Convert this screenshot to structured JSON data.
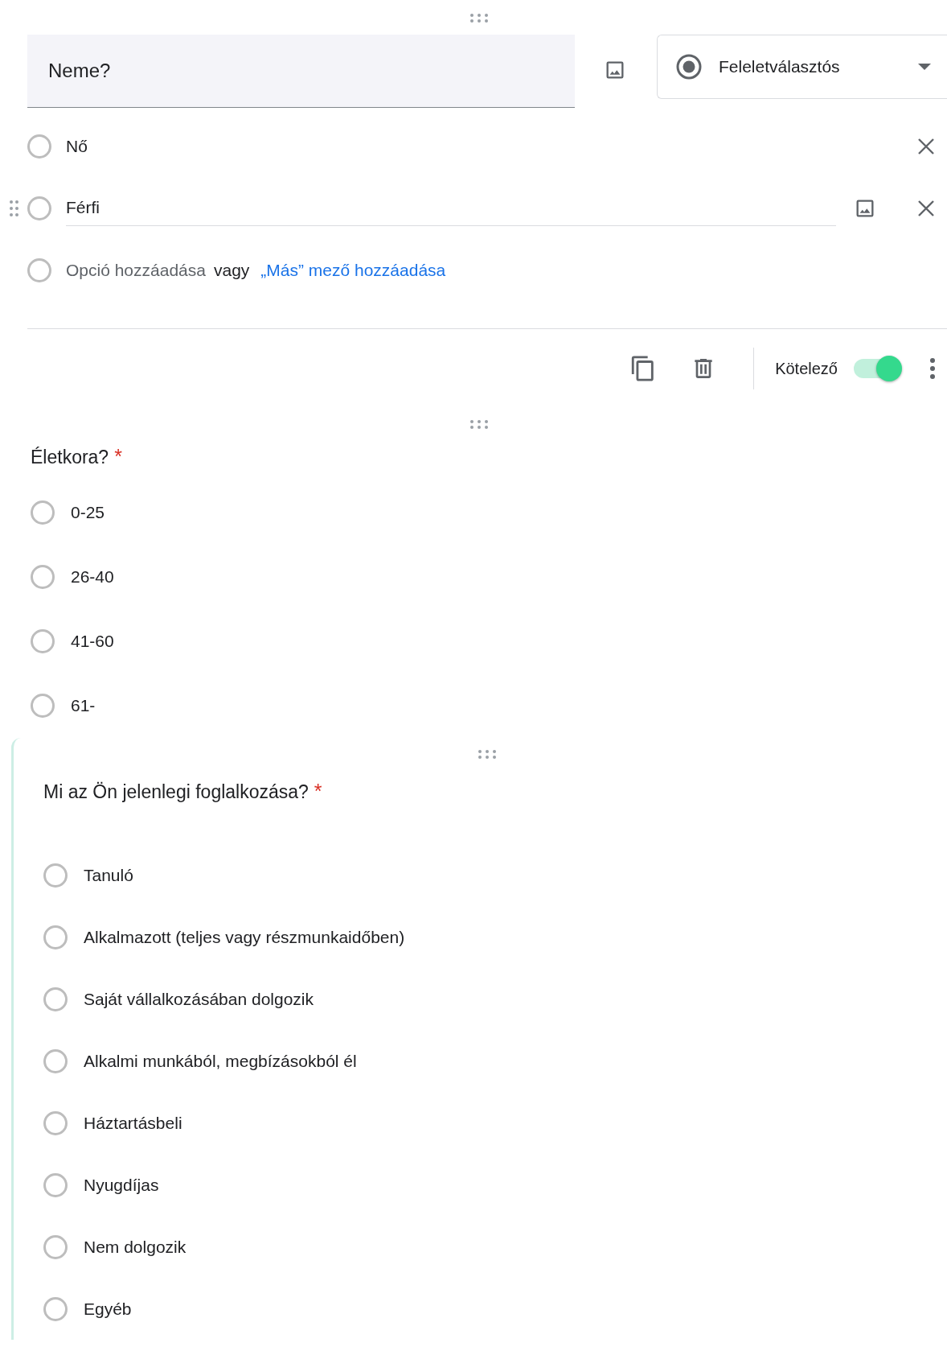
{
  "questions": [
    {
      "title": "Neme?",
      "kind": "editor",
      "type_select": {
        "label": "Feleletválasztós"
      },
      "options": [
        {
          "label": "Nő",
          "selected": false,
          "editing": false
        },
        {
          "label": "Férfi",
          "selected": false,
          "editing": true
        }
      ],
      "add_option": {
        "selected": false,
        "placeholder": "Opció hozzáadása",
        "separator": "vagy",
        "link": "„Más” mező hozzáadása"
      },
      "required_toggle": {
        "label": "Kötelező",
        "on": true
      }
    },
    {
      "title": "Életkora?",
      "kind": "preview",
      "required_mark": "*",
      "options": [
        {
          "label": "0-25",
          "selected": false
        },
        {
          "label": "26-40",
          "selected": false
        },
        {
          "label": "41-60",
          "selected": false
        },
        {
          "label": "61-",
          "selected": false
        }
      ]
    },
    {
      "title": "Mi az Ön jelenlegi foglalkozása?",
      "kind": "preview",
      "required_mark": "*",
      "focused": true,
      "options": [
        {
          "label": "Tanuló",
          "selected": false
        },
        {
          "label": "Alkalmazott (teljes vagy részmunkaidőben)",
          "selected": false
        },
        {
          "label": "Saját vállalkozásában dolgozik",
          "selected": false
        },
        {
          "label": "Alkalmi munkából, megbízásokból él",
          "selected": false
        },
        {
          "label": "Háztartásbeli",
          "selected": false
        },
        {
          "label": "Nyugdíjas",
          "selected": false
        },
        {
          "label": "Nem dolgozik",
          "selected": false
        },
        {
          "label": "Egyéb",
          "selected": false
        }
      ]
    }
  ]
}
